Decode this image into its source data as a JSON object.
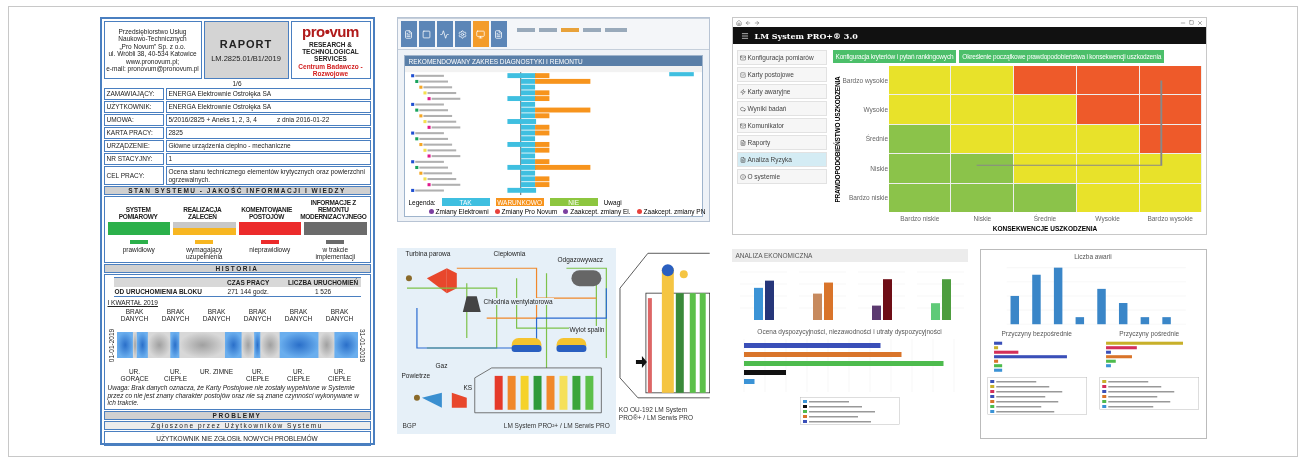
{
  "report": {
    "company": [
      "Przedsiębiorstwo Usług",
      "Naukowo-Technicznych",
      "„Pro Novum” Sp. z o.o.",
      "ul. Wróbli 38, 40-534 Katowice",
      "www.pronovum.pl;",
      "e-mail: pronovum@pronovum.pl"
    ],
    "title": "RAPORT",
    "number": "LM.2825.01/B1/2019",
    "logo": {
      "name": "pro•vum",
      "tagline": "RESEARCH & TECHNOLOGICAL SERVICES",
      "subtitle": "Centrum Badawczo - Rozwojowe"
    },
    "page": "1/6",
    "fields": [
      {
        "label": "ZAMAWIAJĄCY:",
        "value": "ENERGA Elektrownie Ostrołęka SA"
      },
      {
        "label": "UŻYTKOWNIK:",
        "value": "ENERGA Elektrownie Ostrołęka SA"
      },
      {
        "label": "UMOWA:",
        "value": "5/2016/2825 + Aneks 1, 2, 3, 4",
        "extra": "z dnia 2016-01-22"
      },
      {
        "label": "KARTA PRACY:",
        "value": "2825"
      },
      {
        "label": "URZĄDZENIE:",
        "value": "Główne urządzenia cieplno - mechaniczne"
      },
      {
        "label": "NR STACYJNY:",
        "value": "1"
      },
      {
        "label": "CEL PRACY:",
        "value": "Ocena stanu technicznego elementów krytycznych oraz powierzchni ogrzewalnych."
      }
    ],
    "status_title": "STAN SYSTEMU - JAKOŚĆ INFORMACJI I WIEDZY",
    "status": [
      {
        "label": "SYSTEM POMIAROWY",
        "kind": "solid",
        "color": "#2bb04a"
      },
      {
        "label": "REALIZACJA ZALECEŃ",
        "kind": "split",
        "color": "#f7b621"
      },
      {
        "label": "KOMENTOWANIE POSTOJÓW",
        "kind": "solid",
        "color": "#ec2b2b"
      },
      {
        "label": "INFORMACJE Z REMONTU MODERNIZACYJNEGO",
        "kind": "solid",
        "color": "#6b6b6b"
      }
    ],
    "legend": [
      {
        "label": "prawidłowy",
        "color": "#2bb04a"
      },
      {
        "label": "wymagający uzupełnienia",
        "color": "#f7b621"
      },
      {
        "label": "nieprawidłowy",
        "color": "#ec2b2b"
      },
      {
        "label": "w trakcie implementacji",
        "color": "#6b6b6b"
      }
    ],
    "history_title": "HISTORIA",
    "history_columns": [
      "CZAS PRACY",
      "LICZBA URUCHOMIEŃ"
    ],
    "history_row": {
      "label": "OD URUCHOMIENIA BLOKU",
      "cells": [
        "271 144 godz.",
        "1 526"
      ]
    },
    "quarter": "I KWARTAŁ 2019",
    "timeline_start": "01-01-2019",
    "timeline_end": "31-01-2019",
    "timeline_top": [
      "BRAK DANYCH",
      "BRAK DANYCH",
      "BRAK DANYCH",
      "BRAK DANYCH",
      "BRAK DANYCH",
      "BRAK DANYCH"
    ],
    "timeline_bottom": [
      "UR. GORĄCE",
      "UR. CIEPŁE",
      "UR. ZIMNE",
      "UR. CIEPŁE",
      "UR. CIEPŁE",
      "UR. CIEPŁE"
    ],
    "note": "Uwaga: Brak danych oznacza, że Karty Postojowe nie zostały wypełnione w Systemie przez co nie jest znany charakter postojów oraz nie są znane czynności wykonywane w ich trakcie.",
    "problems_title": "PROBLEMY",
    "problems_subtitle": "Zgłoszone przez Użytkowników Systemu",
    "problems_text": "UŻYTKOWNIK NIE ZGŁOSIŁ NOWYCH PROBLEMÓW"
  },
  "planner": {
    "tools": [
      {
        "selected": false
      },
      {
        "selected": false
      },
      {
        "selected": false
      },
      {
        "selected": false
      },
      {
        "selected": true
      },
      {
        "selected": false
      }
    ],
    "panel_title": "REKOMENDOWANY ZAKRES DIAGNOSTYKI I REMONTU",
    "legend_label": "Legenda:",
    "legend": [
      {
        "label": "TAK",
        "color": "#3fbfe0"
      },
      {
        "label": "WARUNKOWO",
        "color": "#f7941d"
      },
      {
        "label": "NIE",
        "color": "#8dc63f"
      }
    ],
    "remarks": "Uwagi",
    "changes": [
      {
        "label": "Zmiany Elektrowni",
        "color": "#7b3fa0"
      },
      {
        "label": "Zmiany Pro Novum",
        "color": "#e8403a"
      },
      {
        "label": "Zaakcept. zmiany El.",
        "color": "#7b3fa0"
      },
      {
        "label": "Zaakcept. zmiany PN",
        "color": "#e8403a"
      }
    ]
  },
  "risk": {
    "title": "LM System PRO+® 3.0",
    "menu": [
      {
        "label": "Konfiguracja pomiarów",
        "selected": false
      },
      {
        "label": "Karty postojowe",
        "selected": false
      },
      {
        "label": "Karty awaryjne",
        "selected": false
      },
      {
        "label": "Wyniki badań",
        "selected": false
      },
      {
        "label": "Komunikator",
        "selected": false
      },
      {
        "label": "Raporty",
        "selected": false
      },
      {
        "label": "Analiza Ryzyka",
        "selected": true
      },
      {
        "label": "O systemie",
        "selected": false
      }
    ],
    "buttons": [
      "Konfiguracja kryteriów i pytań rankingowych",
      "Określenie początkowe prawdopodobieństwa i konsekwencji uszkodzenia"
    ],
    "y_title": "PRAWDOPODOBIEŃSTWO USZKODZENIA",
    "x_title": "KONSEKWENCJE USZKODZENIA",
    "x_labels": [
      "Bardzo niskie",
      "Niskie",
      "Średnie",
      "Wysokie",
      "Bardzo wysokie"
    ],
    "rows": [
      {
        "label": "Bardzo wysokie",
        "cells": [
          {
            "color": "#e8e22a"
          },
          {
            "color": "#e8e22a"
          },
          {
            "color": "#ee5a2a"
          },
          {
            "color": "#ee5a2a"
          },
          {
            "color": "#ee5a2a"
          }
        ]
      },
      {
        "label": "Wysokie",
        "cells": [
          {
            "color": "#e8e22a"
          },
          {
            "color": "#e8e22a"
          },
          {
            "color": "#e8e22a"
          },
          {
            "color": "#ee5a2a"
          },
          {
            "color": "#ee5a2a"
          }
        ]
      },
      {
        "label": "Średnie",
        "cells": [
          {
            "color": "#8bc34a"
          },
          {
            "color": "#e8e22a"
          },
          {
            "color": "#e8e22a"
          },
          {
            "color": "#e8e22a"
          },
          {
            "color": "#ee5a2a"
          }
        ]
      },
      {
        "label": "Niskie",
        "cells": [
          {
            "color": "#8bc34a"
          },
          {
            "color": "#8bc34a"
          },
          {
            "color": "#e8e22a"
          },
          {
            "color": "#e8e22a"
          },
          {
            "color": "#e8e22a"
          }
        ]
      },
      {
        "label": "Bardzo niskie",
        "cells": [
          {
            "color": "#8bc34a"
          },
          {
            "color": "#8bc34a"
          },
          {
            "color": "#8bc34a"
          },
          {
            "color": "#e8e22a"
          },
          {
            "color": "#e8e22a"
          }
        ]
      }
    ]
  },
  "schematic": {
    "labels": [
      "Turbina parowa",
      "Ciepłownia",
      "Odgazowywacz",
      "Chłodnia wentylatorowa",
      "Wylot spalin",
      "Powietrze",
      "Gaz",
      "KS"
    ],
    "left_caption": "BGP",
    "left_footer": "LM System PRO²+ / LM Serwis PRO",
    "right_caption": "KO OU-192  LM System PRO®+ / LM Serwis PRO"
  },
  "economics": {
    "title": "ANALIZA EKONOMICZNA",
    "chart_title": "Ocena dyspozycyjności, niezawodności i utraty dyspozycyjności"
  },
  "failures": {
    "title": "Liczba awarii",
    "left_title": "Przyczyny bezpośrednie",
    "right_title": "Przyczyny pośrednie"
  }
}
